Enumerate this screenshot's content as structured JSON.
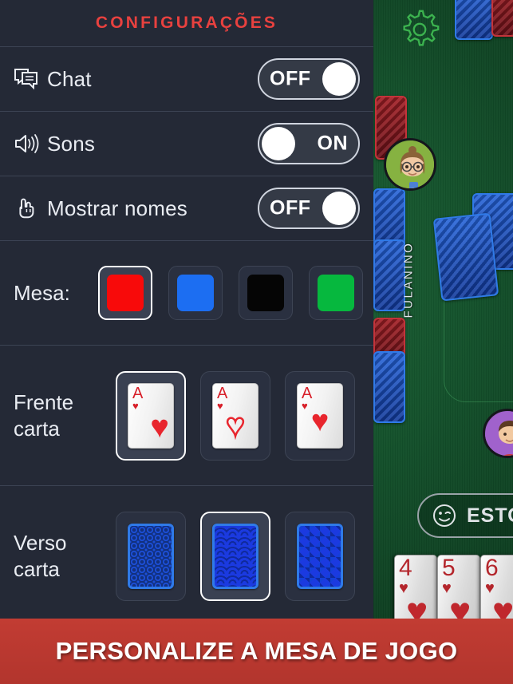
{
  "panel": {
    "title": "CONFIGURAÇÕES",
    "accent_color": "#e8413f",
    "background_color": "#242936"
  },
  "toggles": [
    {
      "icon": "chat-bubble-icon",
      "label": "Chat",
      "state": "OFF",
      "on": false
    },
    {
      "icon": "speaker-icon",
      "label": "Sons",
      "state": "ON",
      "on": true
    },
    {
      "icon": "pointing-hand-icon",
      "label": "Mostrar nomes",
      "state": "OFF",
      "on": false
    }
  ],
  "table_colors": {
    "label": "Mesa:",
    "options": [
      {
        "name": "red",
        "hex": "#f80a0a",
        "selected": true
      },
      {
        "name": "blue",
        "hex": "#1c6ef2",
        "selected": false
      },
      {
        "name": "black",
        "hex": "#050505",
        "selected": false
      },
      {
        "name": "green",
        "hex": "#06b83e",
        "selected": false
      }
    ]
  },
  "card_front": {
    "label": "Frente carta",
    "options": [
      {
        "name": "ace-hearts-solid-offset",
        "rank": "A",
        "suit": "♥",
        "selected": true
      },
      {
        "name": "ace-hearts-outline",
        "rank": "A",
        "suit": "♥",
        "selected": false
      },
      {
        "name": "ace-hearts-solid-center",
        "rank": "A",
        "suit": "♥",
        "selected": false
      }
    ]
  },
  "card_back": {
    "label": "Verso carta",
    "options": [
      {
        "name": "circles-pattern",
        "selected": false
      },
      {
        "name": "fans-pattern",
        "selected": true
      },
      {
        "name": "chevrons-pattern",
        "selected": false
      }
    ]
  },
  "banner": {
    "text": "PERSONALIZE A MESA DE JOGO",
    "background_color": "#bd382f"
  },
  "game": {
    "player_name": "FULANINO",
    "action_button": {
      "label": "ESTO",
      "icon": "wink-smiley-icon"
    },
    "hand_cards": [
      {
        "rank": "4",
        "suit": "♥"
      },
      {
        "rank": "5",
        "suit": "♥"
      },
      {
        "rank": "6",
        "suit": "♥"
      }
    ],
    "settings_gear": "gear-icon"
  }
}
